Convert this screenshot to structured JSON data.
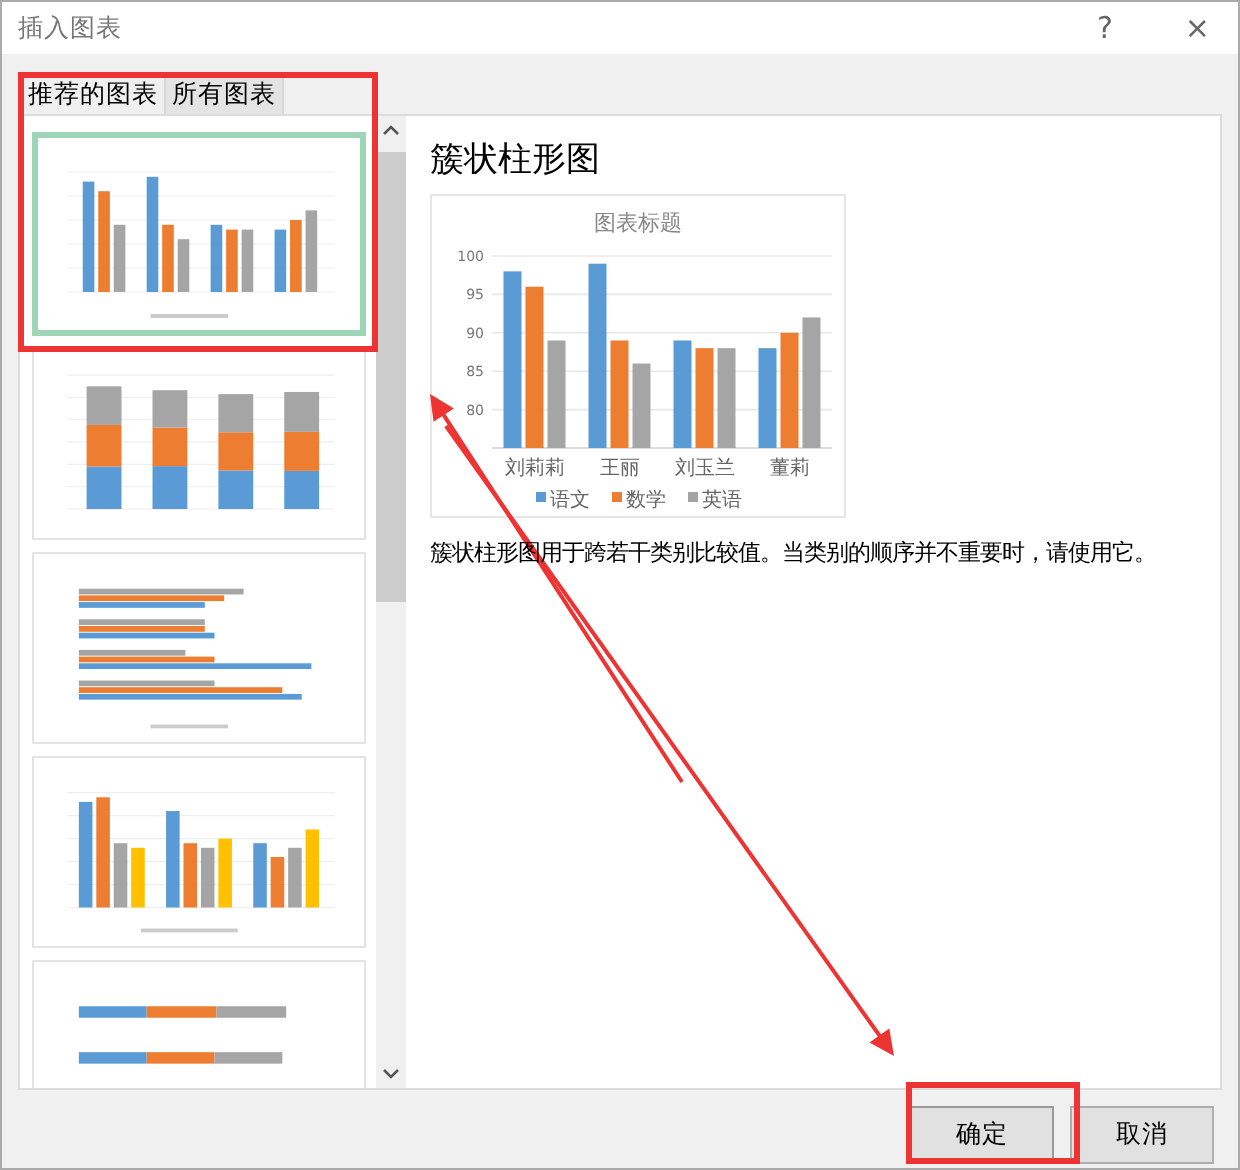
{
  "window": {
    "title": "插入图表",
    "help": "?",
    "close": "×"
  },
  "tabs": [
    {
      "label": "推荐的图表",
      "selected": true
    },
    {
      "label": "所有图表",
      "selected": false
    }
  ],
  "thumbnails": [
    {
      "kind": "clustered-column",
      "selected": true
    },
    {
      "kind": "stacked-column",
      "selected": false
    },
    {
      "kind": "clustered-bar",
      "selected": false
    },
    {
      "kind": "clustered-column-4",
      "selected": false
    },
    {
      "kind": "stacked-bar",
      "selected": false
    }
  ],
  "preview": {
    "title": "簇状柱形图",
    "chart_data": {
      "type": "bar",
      "title": "图表标题",
      "categories": [
        "刘莉莉",
        "王丽",
        "刘玉兰",
        "董莉"
      ],
      "series": [
        {
          "name": "语文",
          "color": "#5b9bd5",
          "values": [
            98,
            99,
            89,
            88
          ]
        },
        {
          "name": "数学",
          "color": "#ed7d31",
          "values": [
            96,
            89,
            88,
            90
          ]
        },
        {
          "name": "英语",
          "color": "#a5a5a5",
          "values": [
            89,
            86,
            88,
            92
          ]
        }
      ],
      "ylim": [
        75,
        100
      ],
      "yticks": [
        80,
        85,
        90,
        95,
        100
      ],
      "grid": true,
      "legend": "bottom"
    },
    "description": "簇状柱形图用于跨若干类别比较值。当类别的顺序并不重要时，请使用它。"
  },
  "buttons": [
    {
      "label": "确定",
      "kind": "primary"
    },
    {
      "label": "取消",
      "kind": "default"
    }
  ],
  "annotations": [
    {
      "kind": "box"
    },
    {
      "kind": "box"
    },
    {
      "kind": "arrow"
    },
    {
      "kind": "arrow"
    }
  ]
}
